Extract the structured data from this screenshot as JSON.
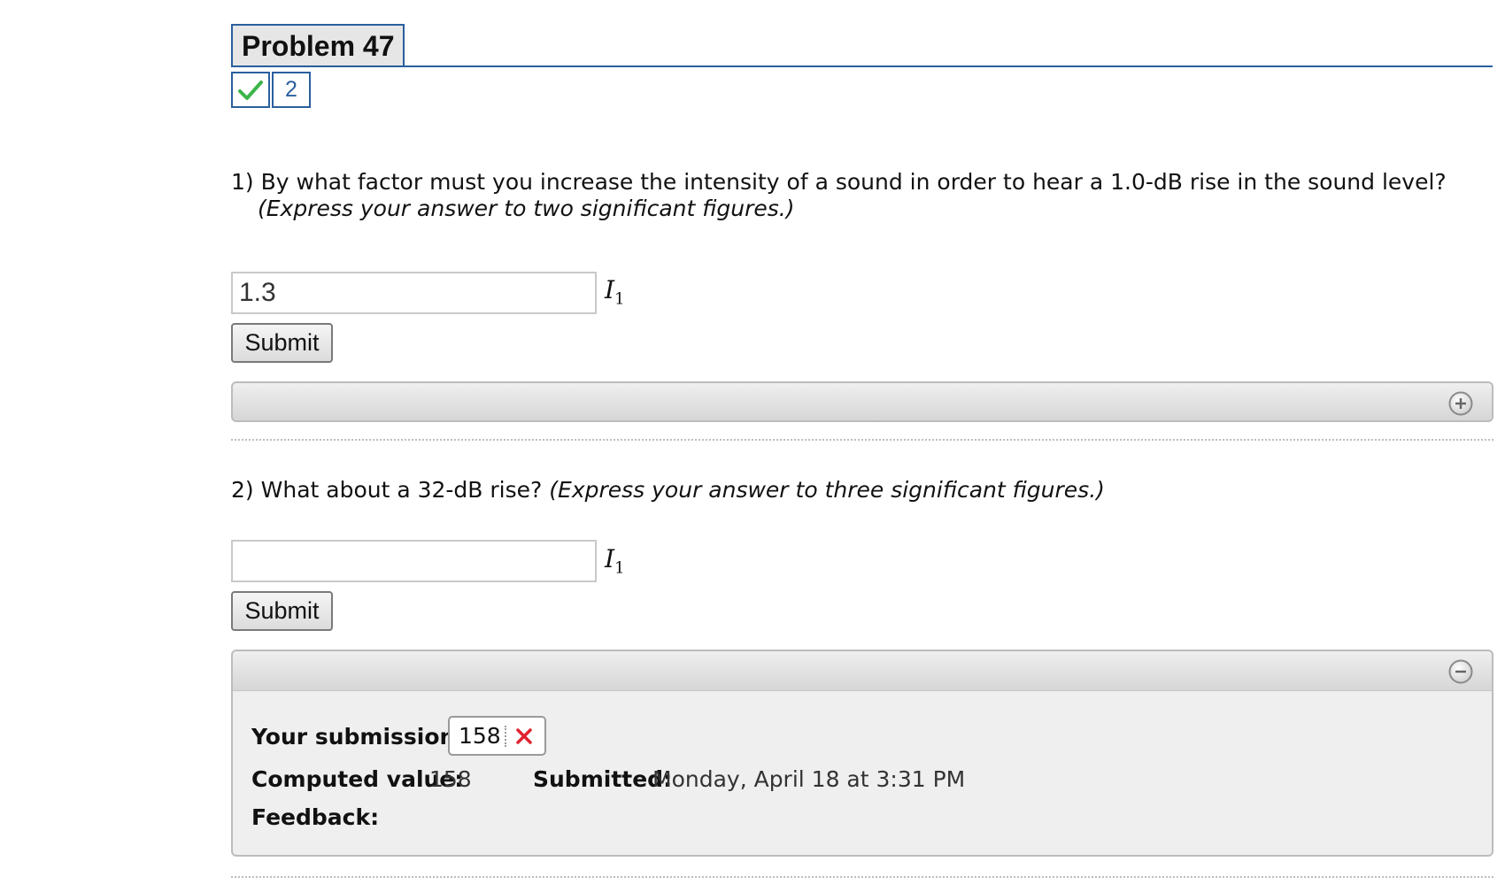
{
  "problem": {
    "title": "Problem 47",
    "attempt_count": "2",
    "status_icon": "check-icon"
  },
  "question1": {
    "number": "1)",
    "text": "By what factor must you increase the intensity of a sound in order to hear a 1.0-dB rise in the sound level?",
    "hint": "(Express your answer to two significant figures.)",
    "answer_value": "1.3",
    "unit_symbol": "I",
    "unit_subscript": "1",
    "submit_label": "Submit",
    "panel_state": "collapsed"
  },
  "question2": {
    "number": "2)",
    "text": "What about a 32-dB rise?",
    "hint": "(Express your answer to three significant figures.)",
    "answer_value": "",
    "unit_symbol": "I",
    "unit_subscript": "1",
    "submit_label": "Submit",
    "panel_state": "expanded",
    "panel": {
      "submissions_label": "Your submissions:",
      "submission_value": "158",
      "submission_status": "incorrect",
      "computed_label": "Computed value:",
      "computed_value": "158",
      "submitted_label": "Submitted:",
      "submitted_value": "Monday, April 18 at 3:31 PM",
      "feedback_label": "Feedback:"
    }
  },
  "colors": {
    "accent": "#2a5f9e",
    "correct": "#3bb54a",
    "incorrect": "#e0232f"
  }
}
